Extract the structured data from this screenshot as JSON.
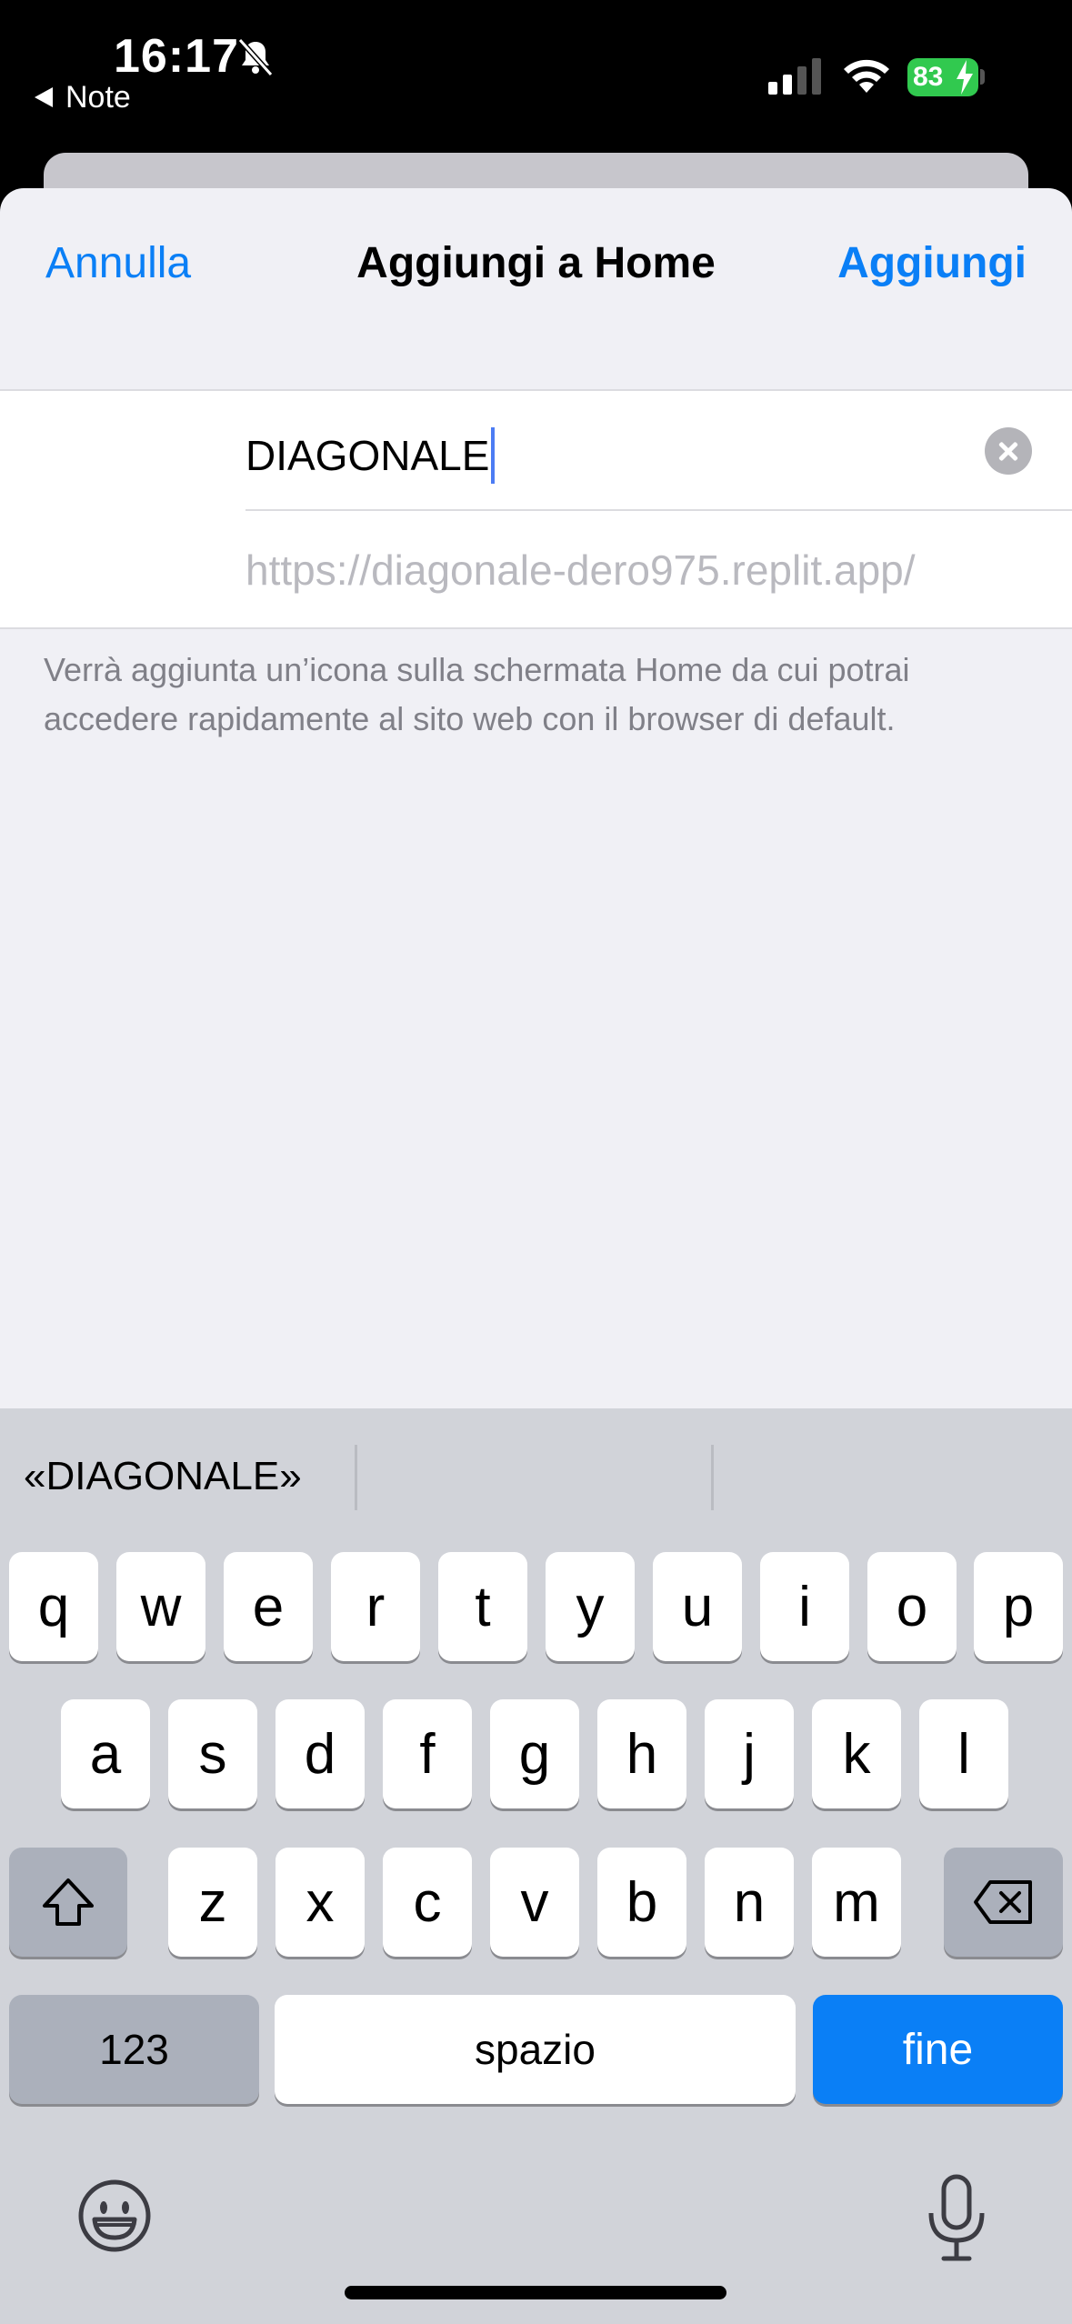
{
  "status_bar": {
    "time": "16:17",
    "back_label": "Note",
    "battery": "83"
  },
  "nav": {
    "cancel_label": "Annulla",
    "title": "Aggiungi a Home",
    "add_label": "Aggiungi"
  },
  "form": {
    "title_value": "DIAGONALE",
    "url": "https://diagonale-dero975.replit.app/"
  },
  "description": "Verrà aggiunta un’icona sulla schermata Home da cui potrai accedere rapidamente al sito web con il browser di default.",
  "keyboard": {
    "suggestion": "«DIAGONALE»",
    "row1": [
      "q",
      "w",
      "e",
      "r",
      "t",
      "y",
      "u",
      "i",
      "o",
      "p"
    ],
    "row2": [
      "a",
      "s",
      "d",
      "f",
      "g",
      "h",
      "j",
      "k",
      "l"
    ],
    "row3": [
      "z",
      "x",
      "c",
      "v",
      "b",
      "n",
      "m"
    ],
    "numbers_label": "123",
    "space_label": "spazio",
    "return_label": "fine"
  },
  "colors": {
    "accent": "#0a7ff6",
    "battery": "#31c94f"
  }
}
